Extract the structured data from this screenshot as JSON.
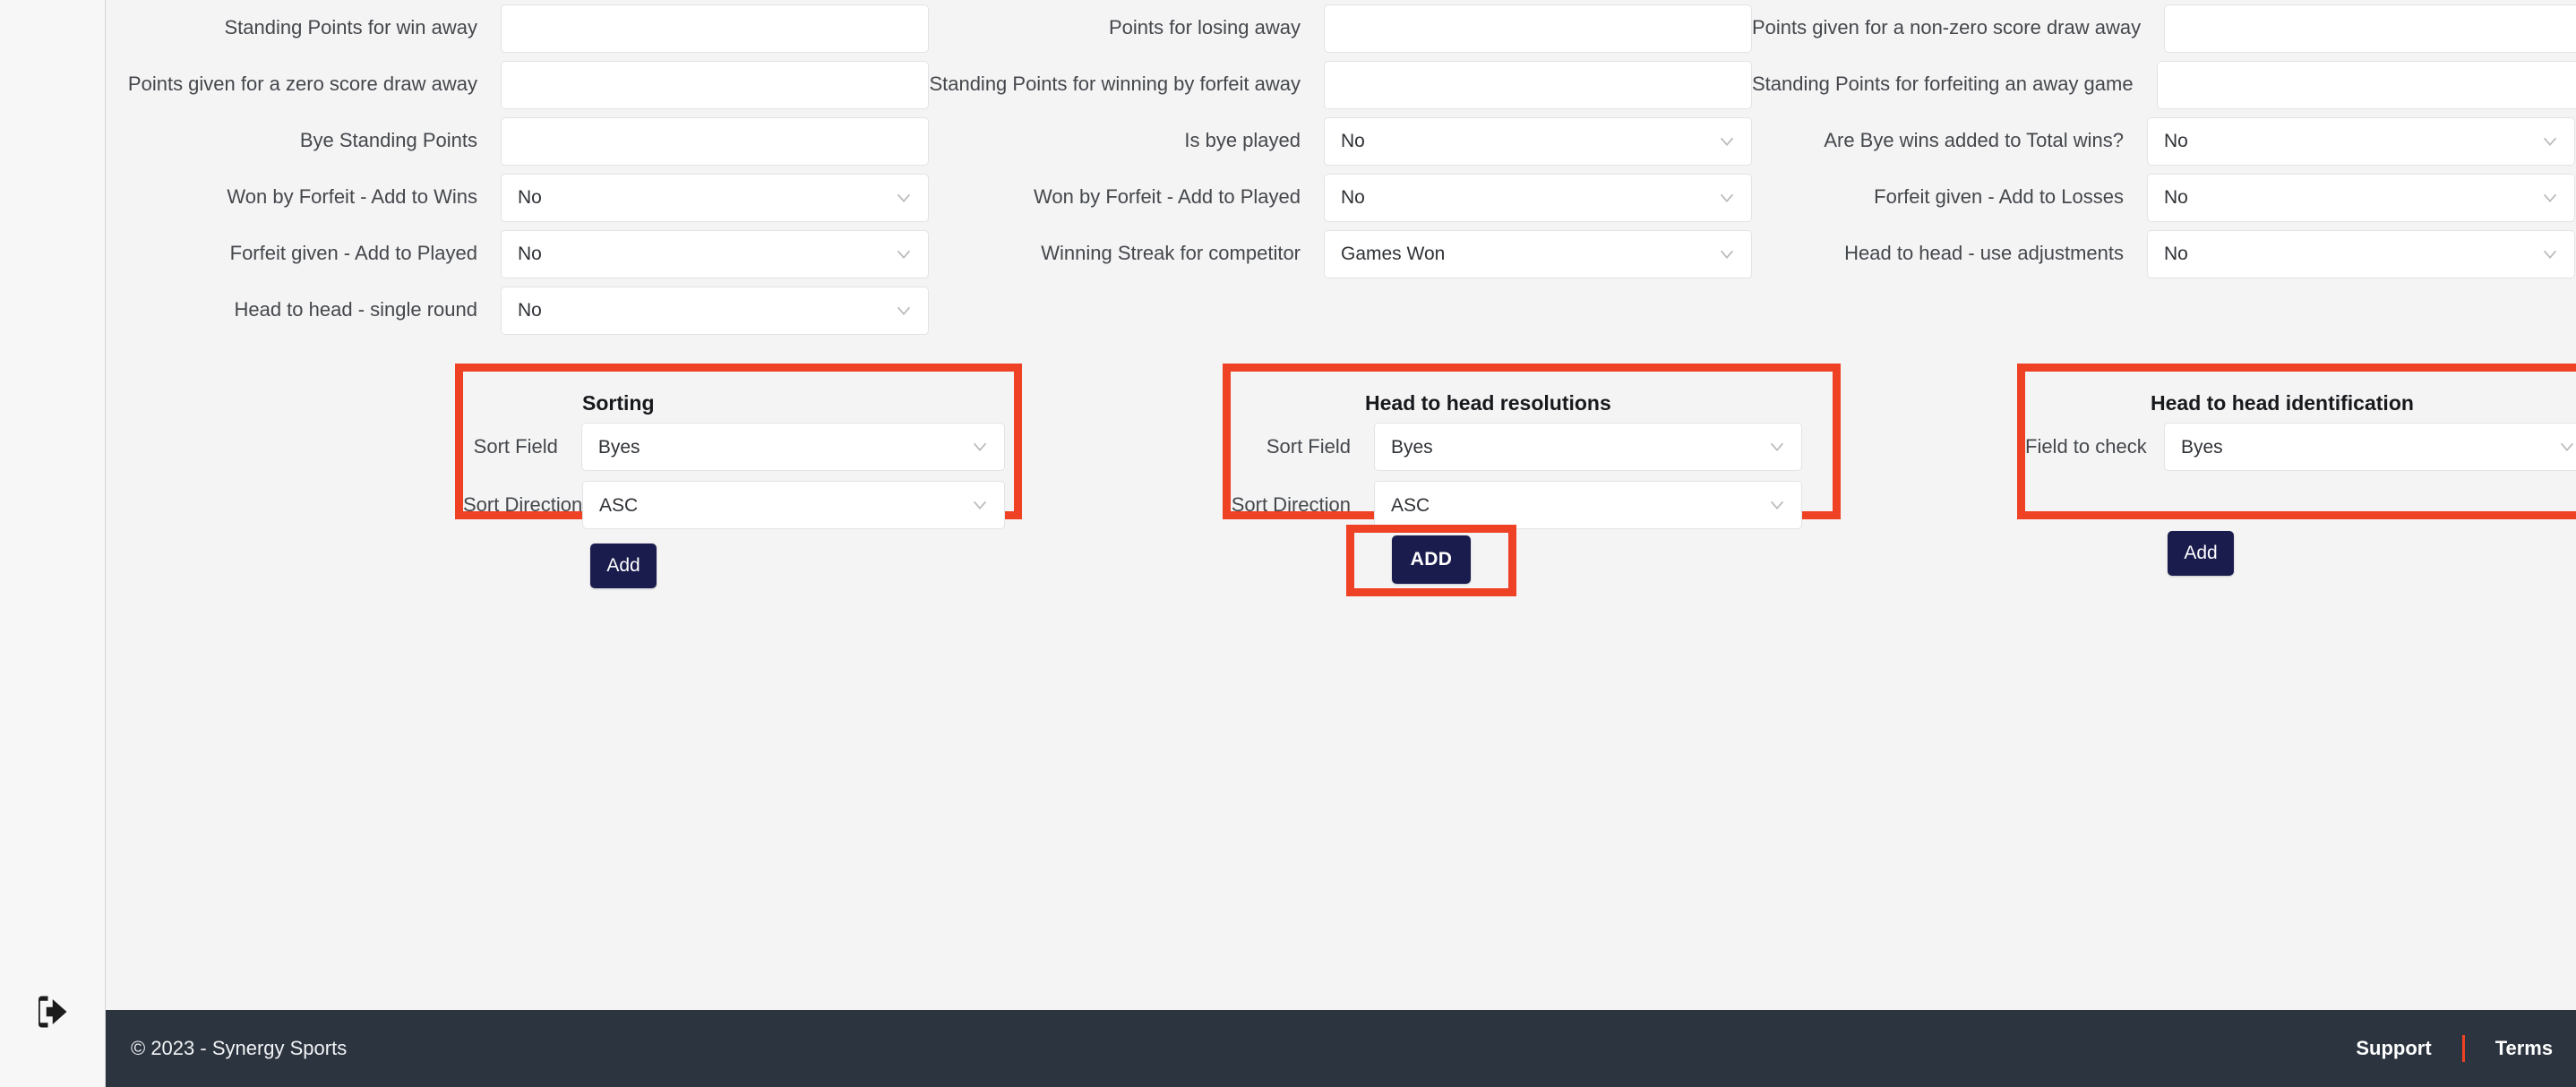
{
  "sidebar": {
    "logout_icon": "logout-icon"
  },
  "form": {
    "rows": [
      [
        {
          "label": "Standing Points for win away",
          "type": "text",
          "value": ""
        },
        {
          "label": "Points for losing away",
          "type": "text",
          "value": ""
        },
        {
          "label": "Points given for a non-zero score draw away",
          "type": "text",
          "value": ""
        }
      ],
      [
        {
          "label": "Points given for a zero score draw away",
          "type": "text",
          "value": ""
        },
        {
          "label": "Standing Points for winning by forfeit away",
          "type": "text",
          "value": ""
        },
        {
          "label": "Standing Points for forfeiting an away game",
          "type": "text",
          "value": ""
        }
      ],
      [
        {
          "label": "Bye Standing Points",
          "type": "text",
          "value": ""
        },
        {
          "label": "Is bye played",
          "type": "select",
          "value": "No"
        },
        {
          "label": "Are Bye wins added to Total wins?",
          "type": "select",
          "value": "No"
        }
      ],
      [
        {
          "label": "Won by Forfeit - Add to Wins",
          "type": "select",
          "value": "No"
        },
        {
          "label": "Won by Forfeit - Add to Played",
          "type": "select",
          "value": "No"
        },
        {
          "label": "Forfeit given - Add to Losses",
          "type": "select",
          "value": "No"
        }
      ],
      [
        {
          "label": "Forfeit given - Add to Played",
          "type": "select",
          "value": "No"
        },
        {
          "label": "Winning Streak for competitor",
          "type": "select",
          "value": "Games Won"
        },
        {
          "label": "Head to head - use adjustments",
          "type": "select",
          "value": "No"
        }
      ],
      [
        {
          "label": "Head to head - single round",
          "type": "select",
          "value": "No"
        },
        {
          "label": "",
          "type": "none",
          "value": ""
        },
        {
          "label": "",
          "type": "none",
          "value": ""
        }
      ]
    ]
  },
  "panels": [
    {
      "title": "Sorting",
      "fields": [
        {
          "label": "Sort Field",
          "value": "Byes"
        },
        {
          "label": "Sort Direction",
          "value": "ASC"
        }
      ],
      "add_label": "Add"
    },
    {
      "title": "Head to head resolutions",
      "fields": [
        {
          "label": "Sort Field",
          "value": "Byes"
        },
        {
          "label": "Sort Direction",
          "value": "ASC"
        }
      ],
      "add_label": "Add"
    },
    {
      "title": "Head to head identification",
      "fields": [
        {
          "label": "Field to check",
          "value": "Byes"
        }
      ],
      "add_label": "Add"
    }
  ],
  "submit": {
    "label": "ADD"
  },
  "footer": {
    "copyright": "© 2023 - Synergy Sports",
    "support_label": "Support",
    "terms_label": "Terms"
  },
  "colors": {
    "highlight": "#ef4123",
    "button_navy": "#1b1c4e",
    "footer_bg": "#2c3440",
    "page_bg": "#f4f4f5"
  }
}
